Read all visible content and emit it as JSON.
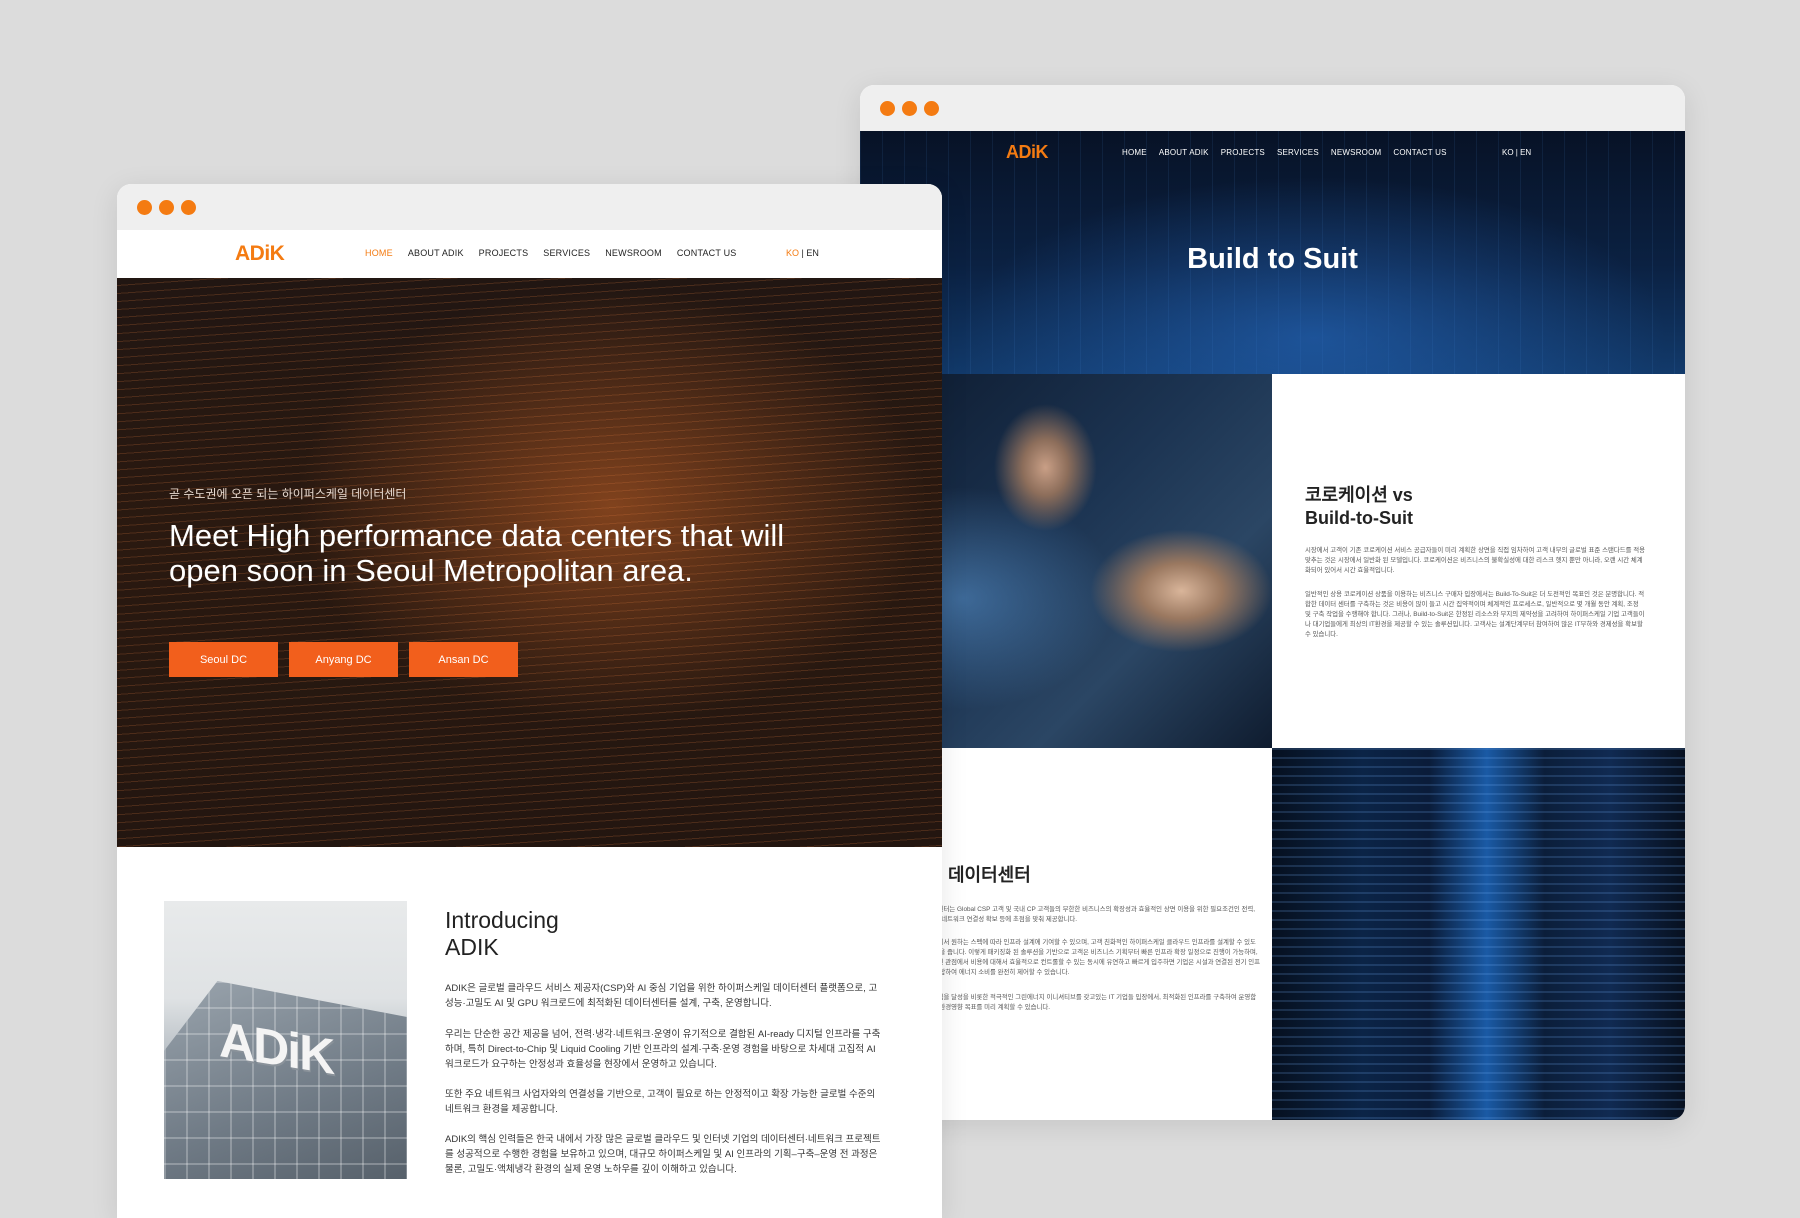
{
  "front": {
    "nav": {
      "logo": "ADiK",
      "items": [
        "HOME",
        "ABOUT ADIK",
        "PROJECTS",
        "SERVICES",
        "NEWSROOM",
        "CONTACT US"
      ],
      "lang_ko": "KO",
      "lang_sep": "|",
      "lang_en": "EN"
    },
    "hero": {
      "subtitle": "곧 수도권에 오픈 되는 하이퍼스케일 데이터센터",
      "title": "Meet High performance data centers that will open soon in Seoul Metropolitan area.",
      "buttons": [
        "Seoul DC",
        "Anyang DC",
        "Ansan DC"
      ]
    },
    "intro": {
      "image_sign": "ADiK",
      "title_line1": "Introducing",
      "title_line2": "ADIK",
      "paragraphs": [
        "ADIK은 글로벌 클라우드 서비스 제공자(CSP)와 AI 중심 기업을 위한 하이퍼스케일 데이터센터 플랫폼으로, 고성능·고밀도 AI 및 GPU 워크로드에 최적화된 데이터센터를 설계, 구축, 운영합니다.",
        "우리는 단순한 공간 제공을 넘어, 전력·냉각·네트워크·운영이 유기적으로 결합된 AI-ready 디지털 인프라를 구축하며, 특히 Direct-to-Chip 및 Liquid Cooling 기반 인프라의 설계·구축·운영 경험을 바탕으로 차세대 고집적 AI 워크로드가 요구하는 안정성과 효율성을 현장에서 운영하고 있습니다.",
        "또한 주요 네트워크 사업자와의 연결성을 기반으로, 고객이 필요로 하는 안정적이고 확장 가능한 글로벌 수준의 네트워크 환경을 제공합니다.",
        "ADIK의 핵심 인력들은 한국 내에서 가장 많은 글로벌 클라우드 및 인터넷 기업의 데이터센터·네트워크 프로젝트를 성공적으로 수행한 경험을 보유하고 있으며, 대규모 하이퍼스케일 및 AI 인프라의 기획–구축–운영 전 과정은 물론, 고밀도·액체냉각 환경의 실제 운영 노하우를 깊이 이해하고 있습니다."
      ]
    }
  },
  "back": {
    "nav": {
      "logo": "ADiK",
      "items": [
        "HOME",
        "ABOUT ADIK",
        "PROJECTS",
        "SERVICES",
        "NEWSROOM",
        "CONTACT US"
      ],
      "lang": "KO | EN"
    },
    "hero_title": "Build to Suit",
    "compare": {
      "title_line1": "코로케이션 vs",
      "title_line2": "Build-to-Suit",
      "p1": "시장에서 고객이 기존 코로케이션 서비스 공급자들이 미리 계획한 상면을 직접 임차하여 고객 내부의 글로벌 표준 스탠다드를 적용 맞추는 것은 시장에서 일반화 된 모델입니다. 코로케이션은 비즈니스의 불확실성에 대한 리스크 헷지 뿐만 아니라, 오랜 시간 체계화되어 있어서 시간 효율적입니다.",
      "p2": "일반적인 상용 코로케이션 상품을 이용하는 비즈니스 구매자 입장에서는 Build-To-Suit은 더 도전적인 목표인 것은 분명합니다. 적합한 데이터 센터를 구축하는 것은 비용이 많이 들고 시간 집약적이며 체계적인 프로세스로, 일반적으로 몇 개월 동안 계획, 조정 및 구축 작업을 수행해야 합니다. 그러나, Build-to-Suit은 한정된 리소스와 부지의 제약성을 고려하여 하이퍼스케일 기업 고객들이나 대기업들에게 최상의 IT환경을 제공할 수 있는 솔루션입니다. 고객사는 설계단계부터 참여하여 많은 IT부하와 경제성을 확보할 수 있습니다."
    },
    "datacenter": {
      "title": "데이터센터",
      "p1": "데이터센터는 Global CSP 고객 및 국내 CP 고객들의 무한한 비즈니스의 확장성과 효율적인 상면 이용을 위한 필요조건인 전력, 냉각 및 네트워크 연결성 확보 등에 초점을 맞춰 제공합니다.",
      "p2": "고객에게서 원하는 스펙에 따라 인프라 설계에 기여할 수 있으며, 고객 친화적인 하이퍼스케일 클라우드 인프라를 설계할 수 있도록 도움을 줍니다. 이렇게 패키징화 된 솔루션을 기반으로 고객은 비즈니스 기획부터 빠른 인프라 확장 일정으로 진행이 가능하며, 합리적인 관점에서 비용에 대해서 효율적으로 컨트롤할 수 있는 동시에 유연하고 빠르게 입주하면 기업은 시설과 연결된 전기 인프라를 포함하여 에너지 소비를 완전히 제어할 수 있습니다.",
      "p3": "탄소중립을 달성을 비롯한 적극적인 그린에너지 이니셔티브를 갖고있는 IT 기업들 입장에서, 최적화된 인프라를 구축하여 운영함으로써 환경영향 목표를 미리 계획할 수 있습니다."
    }
  }
}
